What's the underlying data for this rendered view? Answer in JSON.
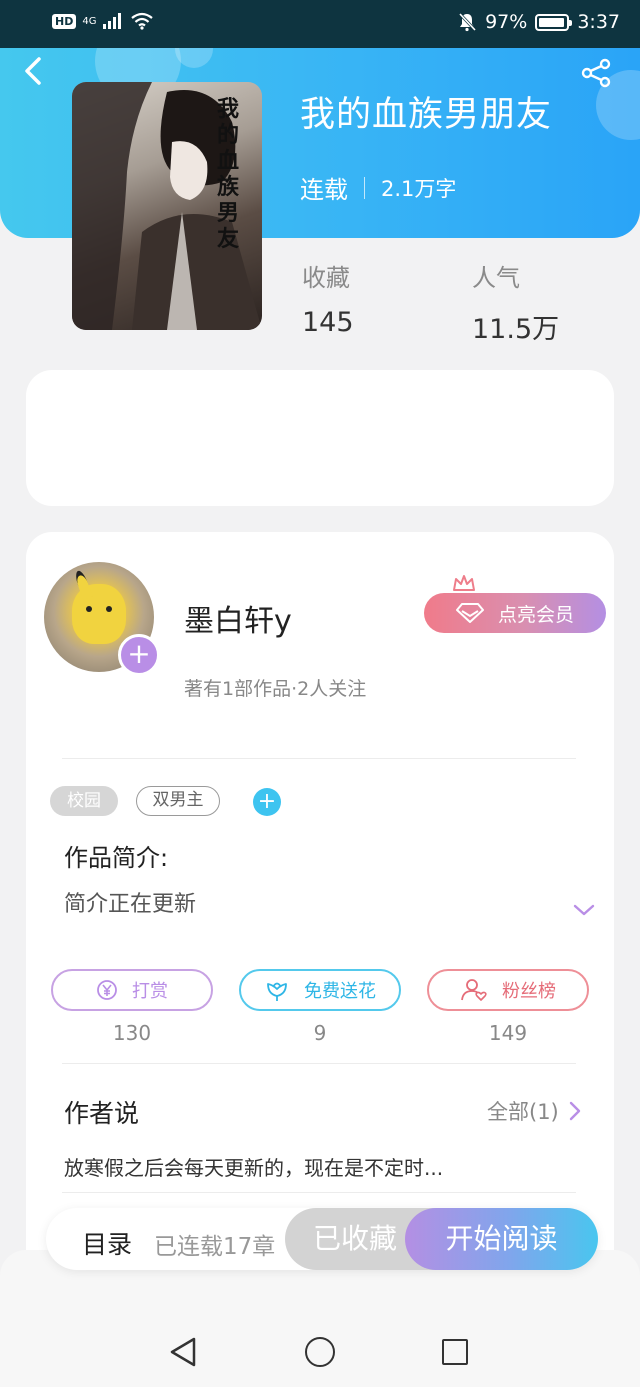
{
  "status_bar": {
    "network_badge": "HD",
    "signal_label": "4G",
    "battery_percent": "97%",
    "battery_level": 0.97,
    "time": "3:37"
  },
  "book": {
    "title": "我的血族男朋友",
    "cover_title": "我的血族男友",
    "status": "连载",
    "word_count": "2.1万字"
  },
  "stats": [
    {
      "label": "收藏",
      "value": "145"
    },
    {
      "label": "人气",
      "value": "11.5万"
    }
  ],
  "author": {
    "name": "墨白轩y",
    "meta": "著有1部作品·2人关注",
    "follow_symbol": "+",
    "vip_label": "点亮会员"
  },
  "tags": [
    "校园",
    "双男主"
  ],
  "tag_add_symbol": "+",
  "intro": {
    "title": "作品简介:",
    "text": "简介正在更新"
  },
  "actions": [
    {
      "label": "打赏",
      "count": "130",
      "icon": "yen-icon"
    },
    {
      "label": "免费送花",
      "count": "9",
      "icon": "flower-icon"
    },
    {
      "label": "粉丝榜",
      "count": "149",
      "icon": "fan-icon"
    }
  ],
  "author_says": {
    "title": "作者说",
    "all_label": "全部(1)",
    "text": "放寒假之后会每天更新的，现在是不定时..."
  },
  "bottom_bar": {
    "toc_label": "目录",
    "chapters_label": "已连载17章",
    "collected_label": "已收藏",
    "read_label": "开始阅读"
  },
  "colors": {
    "header_start": "#45c8ee",
    "header_end": "#2aa4f7",
    "purple_accent": "#b98ee6",
    "blue_accent": "#3ec4f0",
    "pink_accent": "#e56c78"
  }
}
